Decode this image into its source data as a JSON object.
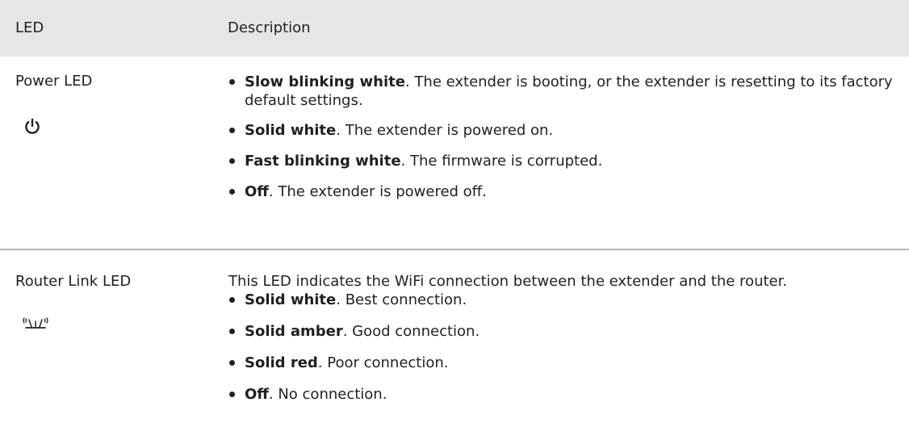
{
  "header": {
    "led": "LED",
    "description": "Description"
  },
  "rows": [
    {
      "led_name": "Power LED",
      "icon": "power-icon",
      "intro": "",
      "bullets": [
        {
          "bold": "Slow blinking white",
          "text": ". The extender is booting, or the extender is resetting to its factory default settings."
        },
        {
          "bold": "Solid white",
          "text": ". The extender is powered on."
        },
        {
          "bold": "Fast blinking white",
          "text": ". The firmware is corrupted."
        },
        {
          "bold": "Off",
          "text": ". The extender is powered off."
        }
      ]
    },
    {
      "led_name": "Router Link LED",
      "icon": "router-link-icon",
      "intro": "This LED indicates the WiFi connection between the extender and the router.",
      "bullets": [
        {
          "bold": "Solid white",
          "text": ". Best connection."
        },
        {
          "bold": "Solid amber",
          "text": ". Good connection."
        },
        {
          "bold": "Solid red",
          "text": ". Poor connection."
        },
        {
          "bold": "Off",
          "text": ". No connection."
        }
      ]
    }
  ]
}
